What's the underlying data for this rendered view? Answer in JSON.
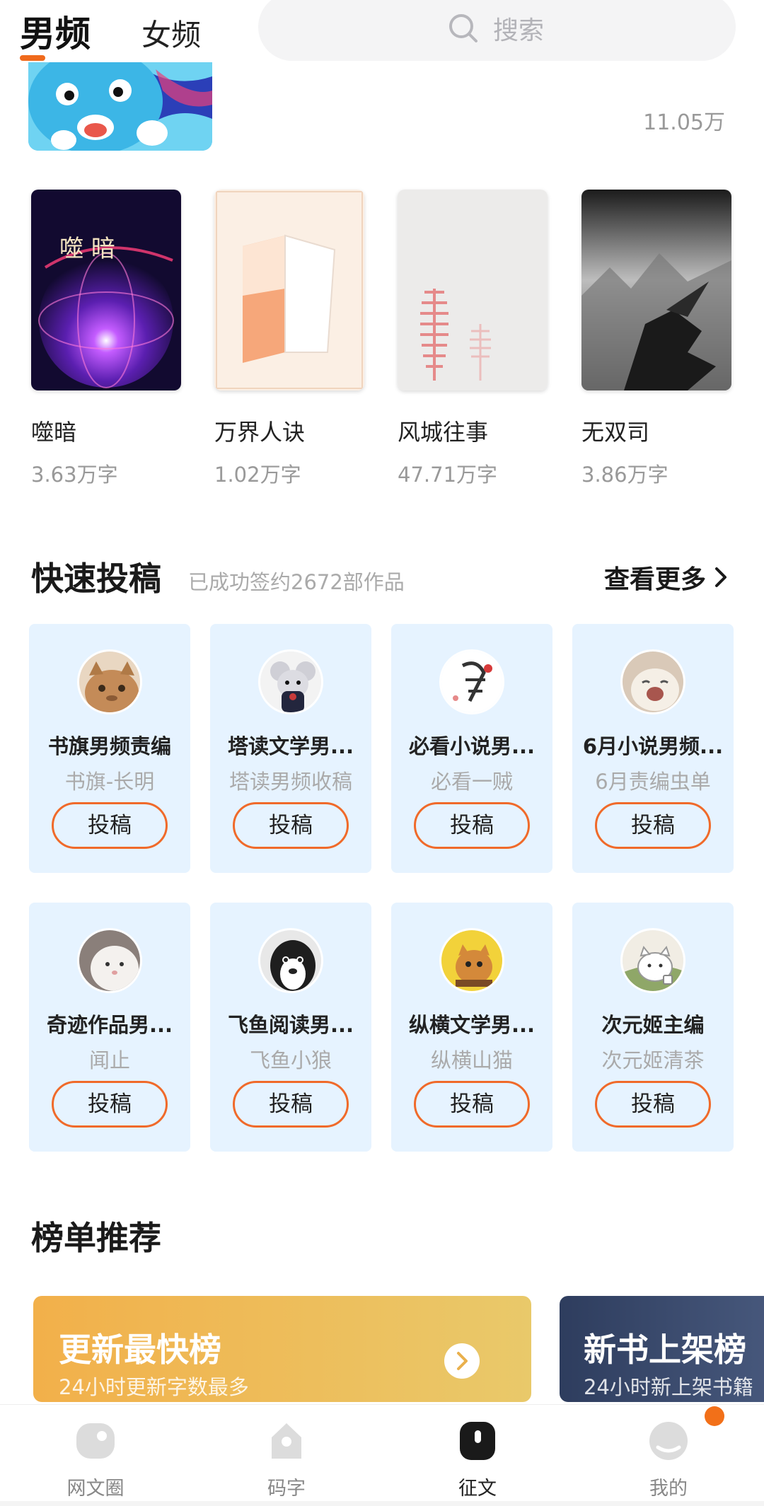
{
  "header": {
    "tabs": [
      "男频",
      "女频"
    ],
    "active_tab": "男频",
    "search_placeholder": "搜索"
  },
  "banner": {
    "count": "11.05万"
  },
  "books": [
    {
      "title": "噬暗",
      "words": "3.63万字",
      "cover_text": "噬 暗"
    },
    {
      "title": "万界人诀",
      "words": "1.02万字"
    },
    {
      "title": "风城往事",
      "words": "47.71万字"
    },
    {
      "title": "无双司",
      "words": "3.86万字"
    }
  ],
  "quick_submit": {
    "title": "快速投稿",
    "subtitle": "已成功签约2672部作品",
    "see_more": "查看更多",
    "cards": [
      {
        "name": "书旗男频责编",
        "editor": "书旗-长明",
        "button": "投稿"
      },
      {
        "name": "塔读文学男...",
        "editor": "塔读男频收稿",
        "button": "投稿"
      },
      {
        "name": "必看小说男...",
        "editor": "必看一贼",
        "button": "投稿"
      },
      {
        "name": "6月小说男频...",
        "editor": "6月责编虫单",
        "button": "投稿"
      },
      {
        "name": "奇迹作品男...",
        "editor": "闻止",
        "button": "投稿"
      },
      {
        "name": "飞鱼阅读男...",
        "editor": "飞鱼小狼",
        "button": "投稿"
      },
      {
        "name": "纵横文学男...",
        "editor": "纵横山猫",
        "button": "投稿"
      },
      {
        "name": "次元姬主编",
        "editor": "次元姬清茶",
        "button": "投稿"
      }
    ]
  },
  "rankings": {
    "title": "榜单推荐",
    "items": [
      {
        "title": "更新最快榜",
        "subtitle": "24小时更新字数最多"
      },
      {
        "title": "新书上架榜",
        "subtitle": "24小时新上架书籍"
      }
    ]
  },
  "bottom_nav": {
    "items": [
      {
        "label": "网文圈",
        "icon": "circle-chat-icon"
      },
      {
        "label": "码字",
        "icon": "pen-icon"
      },
      {
        "label": "征文",
        "icon": "contest-icon"
      },
      {
        "label": "我的",
        "icon": "profile-icon"
      }
    ],
    "active": "征文"
  },
  "colors": {
    "accent": "#f06a1c",
    "card_bg": "#e6f3ff",
    "badge": "#f27019"
  }
}
